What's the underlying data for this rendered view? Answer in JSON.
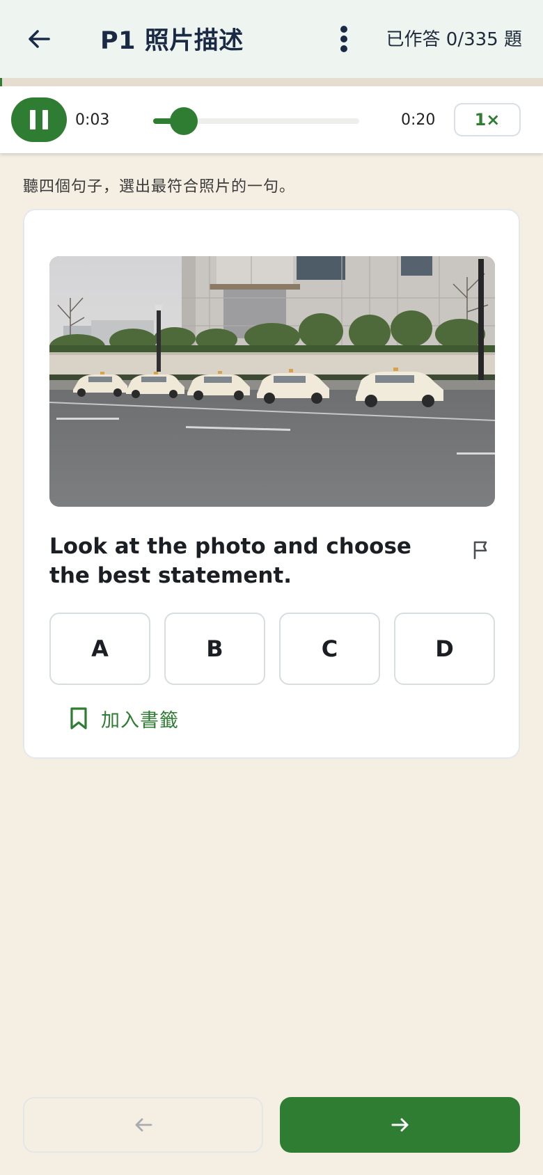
{
  "header": {
    "title": "P1 照片描述",
    "answered_text": "已作答 0/335 題",
    "answered_count": 0,
    "total_count": 335,
    "back_icon": "arrow-left-icon",
    "more_icon": "more-vertical-icon"
  },
  "audio": {
    "current_time": "0:03",
    "total_time": "0:20",
    "progress": 0.15,
    "speed_label": "1×",
    "play_state_icon": "pause-icon"
  },
  "instruction": "聽四個句子，選出最符合照片的一句。",
  "question": {
    "text": "Look at the photo and choose the best statement.",
    "image_description_icon": "photo-taxis-street",
    "flag_icon": "flag-icon",
    "options": [
      "A",
      "B",
      "C",
      "D"
    ],
    "bookmark_label": "加入書籤",
    "bookmark_icon": "bookmark-icon"
  },
  "nav": {
    "prev_icon": "arrow-left-icon",
    "next_icon": "arrow-right-icon"
  },
  "colors": {
    "accent": "#2e7d32",
    "background": "#f5efe3",
    "header_bg": "#eef5f0"
  }
}
